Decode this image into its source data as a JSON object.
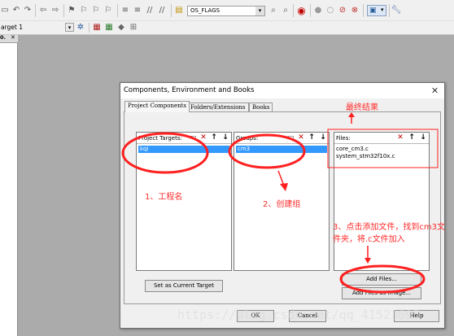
{
  "toolbar": {
    "target_select_value": "OS_FLAGS",
    "target_name": "arget 1"
  },
  "left_pane": {
    "tab_label": "0."
  },
  "dialog": {
    "title": "Components, Environment and Books",
    "close_glyph": "✕",
    "tabs": [
      "Project Components",
      "Folders/Extensions",
      "Books"
    ],
    "project_targets": {
      "label": "Project Targets:",
      "items": [
        "kqi"
      ]
    },
    "groups": {
      "label": "Groups:",
      "items": [
        "cm3"
      ]
    },
    "files": {
      "label": "Files:",
      "items": [
        "core_cm3.c",
        "system_stm32f10x.c"
      ]
    },
    "buttons": {
      "set_current": "Set as Current Target",
      "add_files": "Add Files...",
      "add_files_image": "Add Files as Image...",
      "ok": "OK",
      "cancel": "Cancel",
      "help": "Help"
    }
  },
  "annotations": {
    "final_result": "最终结果",
    "step1": "1、工程名",
    "step2": "2、创建组",
    "step3_line1": "3、点击添加文件，找到cm3文",
    "step3_line2": "件夹，将.c文件加入"
  },
  "watermark": "https://blog.csdn.net/qq_41523695",
  "colors": {
    "annotation_red": "#ff2020",
    "selection_blue": "#3399ff"
  },
  "icons": [
    "undo-icon",
    "redo-icon",
    "back-icon",
    "forward-icon",
    "bookmark-icon",
    "find-icon",
    "debug-icon",
    "breakpoint-icon",
    "settings-icon"
  ]
}
